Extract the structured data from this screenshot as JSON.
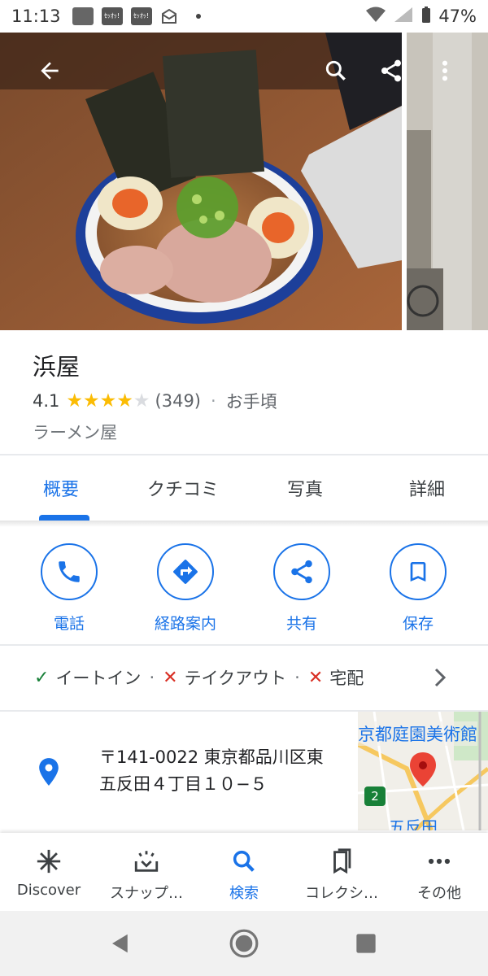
{
  "status_bar": {
    "time": "11:13",
    "app_badge_1": "ｾｯｵｯ!",
    "app_badge_2": "ｾｯｵｯ!",
    "battery": "47%"
  },
  "place": {
    "name": "浜屋",
    "rating": "4.1",
    "stars_filled": 4,
    "stars_total": 5,
    "review_count": "(349)",
    "price": "お手頃",
    "category": "ラーメン屋"
  },
  "tabs": [
    {
      "label": "概要",
      "active": true
    },
    {
      "label": "クチコミ",
      "active": false
    },
    {
      "label": "写真",
      "active": false
    },
    {
      "label": "詳細",
      "active": false
    }
  ],
  "actions": [
    {
      "label": "電話",
      "icon": "phone-icon"
    },
    {
      "label": "経路案内",
      "icon": "directions-icon"
    },
    {
      "label": "共有",
      "icon": "share-icon"
    },
    {
      "label": "保存",
      "icon": "bookmark-icon"
    }
  ],
  "services": [
    {
      "label": "イートイン",
      "available": true
    },
    {
      "label": "テイクアウト",
      "available": false
    },
    {
      "label": "宅配",
      "available": false
    }
  ],
  "address": {
    "line1": "〒141-0022 東京都品川区東",
    "line2": "五反田４丁目１０−５"
  },
  "map_thumb": {
    "label_top": "京都庭園美術館",
    "label_bottom": "五反田",
    "route_badge": "2"
  },
  "bottom_nav": [
    {
      "label": "Discover",
      "icon": "discover-icon",
      "active": false
    },
    {
      "label": "スナップ…",
      "icon": "snap-icon",
      "active": false
    },
    {
      "label": "検索",
      "icon": "search-icon",
      "active": true
    },
    {
      "label": "コレクシ…",
      "icon": "collection-icon",
      "active": false
    },
    {
      "label": "その他",
      "icon": "more-icon",
      "active": false
    }
  ],
  "colors": {
    "accent": "#1a73e8",
    "star": "#fbbc04",
    "check": "#188038",
    "cross": "#d93025"
  }
}
